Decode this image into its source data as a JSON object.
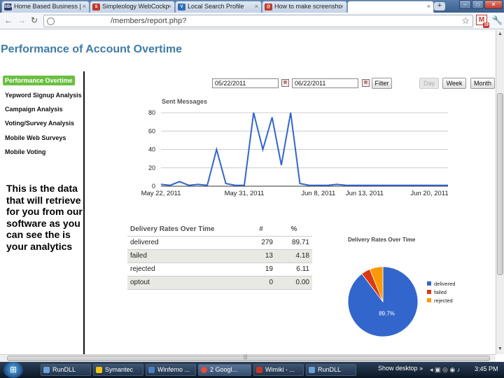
{
  "browser": {
    "tabs": [
      {
        "label": "Home Based Business |",
        "favicon": "SBA",
        "favicon_color": "#2a3f6b"
      },
      {
        "label": "Simpleology WebCockp",
        "favicon": "S",
        "favicon_color": "#c0392b"
      },
      {
        "label": "Local Search Profile",
        "favicon": "V",
        "favicon_color": "#2e6db4"
      },
      {
        "label": "How to make screensho",
        "favicon": "@",
        "favicon_color": "#c0392b"
      },
      {
        "label": "",
        "favicon": "",
        "favicon_color": "#ffffff"
      }
    ],
    "url": "/members/report.php?",
    "gmail_badge": "19"
  },
  "page": {
    "title": "Performance of Account Overtime",
    "nav": [
      "Performance Overtime",
      "Yepword Signup Analysis",
      "Campaign Analysis",
      "Voting/Survey Analysis",
      "Mobile Web Surveys",
      "Mobile Voting"
    ],
    "note": "This is the data that will retrieve for you from our software as you can see the is your analytics",
    "filter": {
      "start_date": "05/22/2011",
      "end_date": "06/22/2011",
      "filter_label": "Filter",
      "range_buttons": [
        "Day",
        "Week",
        "Month"
      ]
    }
  },
  "chart_data": [
    {
      "type": "line",
      "title": "Sent Messages",
      "x_tick_labels": [
        "May 22, 2011",
        "May 31, 2011",
        "Jun 8, 2011",
        "Jun 13, 2011",
        "Jun 20, 2011"
      ],
      "y_tick_labels": [
        "0",
        "20",
        "40",
        "60",
        "80"
      ],
      "ylim": [
        0,
        80
      ],
      "grid": true,
      "x": [
        "2011-05-22",
        "2011-05-23",
        "2011-05-24",
        "2011-05-25",
        "2011-05-26",
        "2011-05-27",
        "2011-05-28",
        "2011-05-29",
        "2011-05-30",
        "2011-05-31",
        "2011-06-01",
        "2011-06-02",
        "2011-06-03",
        "2011-06-04",
        "2011-06-05",
        "2011-06-06",
        "2011-06-07",
        "2011-06-08",
        "2011-06-09",
        "2011-06-10",
        "2011-06-11",
        "2011-06-12",
        "2011-06-13",
        "2011-06-14",
        "2011-06-15",
        "2011-06-16",
        "2011-06-17",
        "2011-06-18",
        "2011-06-19",
        "2011-06-20",
        "2011-06-21",
        "2011-06-22"
      ],
      "series": [
        {
          "color": "#3366cc",
          "values": [
            2,
            1,
            5,
            1,
            2,
            1,
            40,
            3,
            1,
            1,
            80,
            40,
            75,
            23,
            80,
            3,
            1,
            1,
            1,
            2,
            1,
            1,
            1,
            1,
            1,
            1,
            1,
            1,
            1,
            1,
            1,
            1
          ]
        }
      ]
    },
    {
      "type": "table",
      "title": "Delivery Rates Over Time",
      "columns": [
        "Delivery Rates Over Time",
        "#",
        "%"
      ],
      "rows": [
        [
          "delivered",
          "279",
          "89.71"
        ],
        [
          "failed",
          "13",
          "4.18"
        ],
        [
          "rejected",
          "19",
          "6.11"
        ],
        [
          "optout",
          "0",
          "0.00"
        ]
      ]
    },
    {
      "type": "pie",
      "title": "Delivery Rates Over Time",
      "legend_position": "right",
      "slices": [
        {
          "label": "delivered",
          "value": 89.71,
          "color": "#3366cc",
          "data_label": "89.7%"
        },
        {
          "label": "failed",
          "value": 4.18,
          "color": "#dc3912"
        },
        {
          "label": "rejected",
          "value": 6.11,
          "color": "#ff9900"
        }
      ]
    }
  ],
  "taskbar": {
    "items": [
      {
        "label": "RunDLL",
        "icon_color": "#6aa2d8"
      },
      {
        "label": "Symantec",
        "icon_color": "#f1c40f"
      },
      {
        "label": "Winferno ...",
        "icon_color": "#4a7fc1"
      },
      {
        "label": "2 Googl...",
        "icon_color": "#e74c3c"
      },
      {
        "label": "Wimiki - ...",
        "icon_color": "#c0392b"
      },
      {
        "label": "RunDLL",
        "icon_color": "#6aa2d8"
      }
    ],
    "show_desktop": "Show desktop",
    "clock": "3:45 PM"
  }
}
